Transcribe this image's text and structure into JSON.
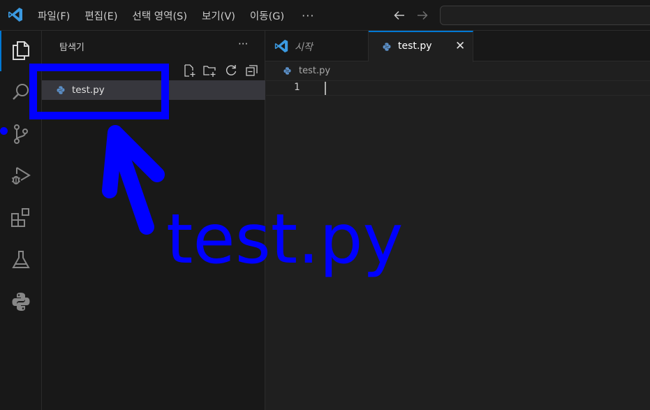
{
  "menu": {
    "items": [
      "파일(F)",
      "편집(E)",
      "선택 영역(S)",
      "보기(V)",
      "이동(G)"
    ],
    "more": "···"
  },
  "icons": {
    "app": "vscode-logo-icon",
    "back": "arrow-left-icon",
    "forward": "arrow-right-icon",
    "activity": [
      "explorer-icon",
      "search-icon",
      "source-control-icon",
      "run-debug-icon",
      "extensions-icon",
      "testing-flask-icon",
      "python-icon"
    ],
    "sidebar_tools": [
      "new-file-icon",
      "new-folder-icon",
      "refresh-icon",
      "collapse-all-icon"
    ]
  },
  "sidebar": {
    "title": "탐색기",
    "more": "···",
    "files": [
      {
        "name": "test.py",
        "selected": true
      }
    ]
  },
  "tabs": [
    {
      "label": "시작",
      "active": false
    },
    {
      "label": "test.py",
      "active": true,
      "close": "✕"
    }
  ],
  "breadcrumb": {
    "file": "test.py"
  },
  "editor": {
    "line_numbers": [
      "1"
    ]
  },
  "annotation": {
    "text": "test.py",
    "color": "#0000ff"
  },
  "colors": {
    "accent": "#0078d4",
    "python_blue": "#5b8fc7",
    "annotation": "#0000ff"
  }
}
